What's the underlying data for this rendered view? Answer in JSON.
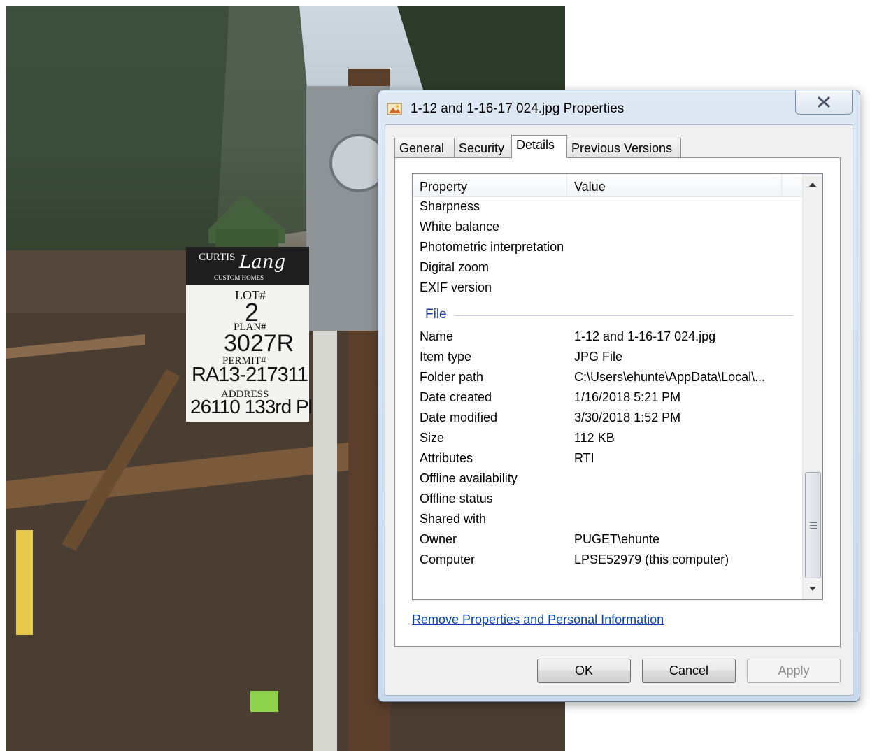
{
  "dialog": {
    "title": "1-12 and 1-16-17 024.jpg Properties",
    "close_label": "X"
  },
  "tabs": [
    {
      "label": "General"
    },
    {
      "label": "Security"
    },
    {
      "label": "Details"
    },
    {
      "label": "Previous Versions"
    }
  ],
  "list": {
    "columns": [
      "Property",
      "Value"
    ],
    "rows_top": [
      {
        "property": "Sharpness",
        "value": ""
      },
      {
        "property": "White balance",
        "value": ""
      },
      {
        "property": "Photometric interpretation",
        "value": ""
      },
      {
        "property": "Digital zoom",
        "value": ""
      },
      {
        "property": "EXIF version",
        "value": ""
      }
    ],
    "group_label": "File",
    "rows_file": [
      {
        "property": "Name",
        "value": "1-12 and 1-16-17 024.jpg"
      },
      {
        "property": "Item type",
        "value": "JPG File"
      },
      {
        "property": "Folder path",
        "value": "C:\\Users\\ehunte\\AppData\\Local\\..."
      },
      {
        "property": "Date created",
        "value": "1/16/2018 5:21 PM"
      },
      {
        "property": "Date modified",
        "value": "3/30/2018 1:52 PM"
      },
      {
        "property": "Size",
        "value": "112 KB"
      },
      {
        "property": "Attributes",
        "value": "RTI"
      },
      {
        "property": "Offline availability",
        "value": ""
      },
      {
        "property": "Offline status",
        "value": ""
      },
      {
        "property": "Shared with",
        "value": ""
      },
      {
        "property": "Owner",
        "value": "PUGET\\ehunte"
      },
      {
        "property": "Computer",
        "value": "LPSE52979 (this computer)"
      }
    ]
  },
  "link": {
    "remove_label": "Remove Properties and Personal Information"
  },
  "buttons": {
    "ok": "OK",
    "cancel": "Cancel",
    "apply": "Apply"
  },
  "photo_sign": {
    "brand_top": "CURTIS",
    "brand_script": "Lang",
    "brand_sub": "CUSTOM HOMES",
    "lot_label": "LOT#",
    "lot_value": "2",
    "plan_label": "PLAN#",
    "plan_value": "3027R",
    "permit_label": "PERMIT#",
    "permit_value": "RA13-217311",
    "address_label": "ADDRESS",
    "address_value": "26110 133rd Pl"
  }
}
